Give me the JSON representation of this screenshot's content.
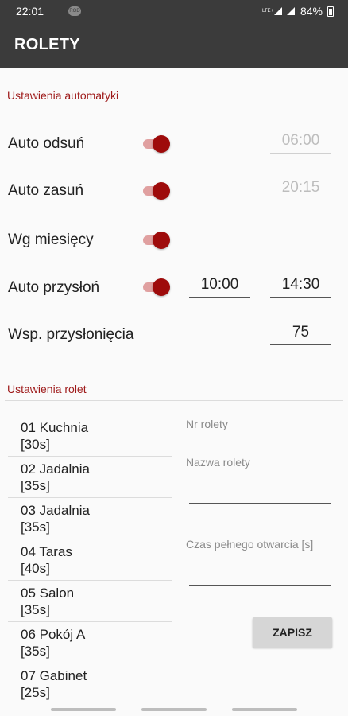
{
  "status_bar": {
    "time": "22:01",
    "notification_badge": "ROD",
    "network_label": "LTE+",
    "battery_percent": "84%"
  },
  "app_bar": {
    "title": "ROLETY"
  },
  "automation": {
    "header": "Ustawienia automatyki",
    "rows": [
      {
        "label": "Auto odsuń",
        "switch_on": true,
        "time_1": "06:00",
        "time_1_enabled": false
      },
      {
        "label": "Auto zasuń",
        "switch_on": true,
        "time_1": "20:15",
        "time_1_enabled": false
      },
      {
        "label": "Wg miesięcy",
        "switch_on": true
      },
      {
        "label": "Auto przysłoń",
        "switch_on": true,
        "time_1": "10:00",
        "time_2": "14:30"
      },
      {
        "label": "Wsp. przysłonięcia",
        "value": "75"
      }
    ]
  },
  "rollers": {
    "header": "Ustawienia rolet",
    "items": [
      {
        "name": "01 Kuchnia",
        "time": "[30s]"
      },
      {
        "name": "02 Jadalnia",
        "time": "[35s]"
      },
      {
        "name": "03 Jadalnia",
        "time": "[35s]"
      },
      {
        "name": "04 Taras",
        "time": "[40s]"
      },
      {
        "name": "05 Salon",
        "time": "[35s]"
      },
      {
        "name": "06 Pokój A",
        "time": "[35s]"
      },
      {
        "name": "07 Gabinet",
        "time": "[25s]"
      }
    ],
    "form": {
      "number_label": "Nr rolety",
      "name_label": "Nazwa rolety",
      "duration_label": "Czas pełnego otwarcia [s]",
      "save_label": "ZAPISZ"
    }
  },
  "colors": {
    "accent": "#9e0b0b",
    "header_text": "#9e1a1a",
    "bar_background": "#3b3b3b",
    "background": "#fafafa"
  }
}
